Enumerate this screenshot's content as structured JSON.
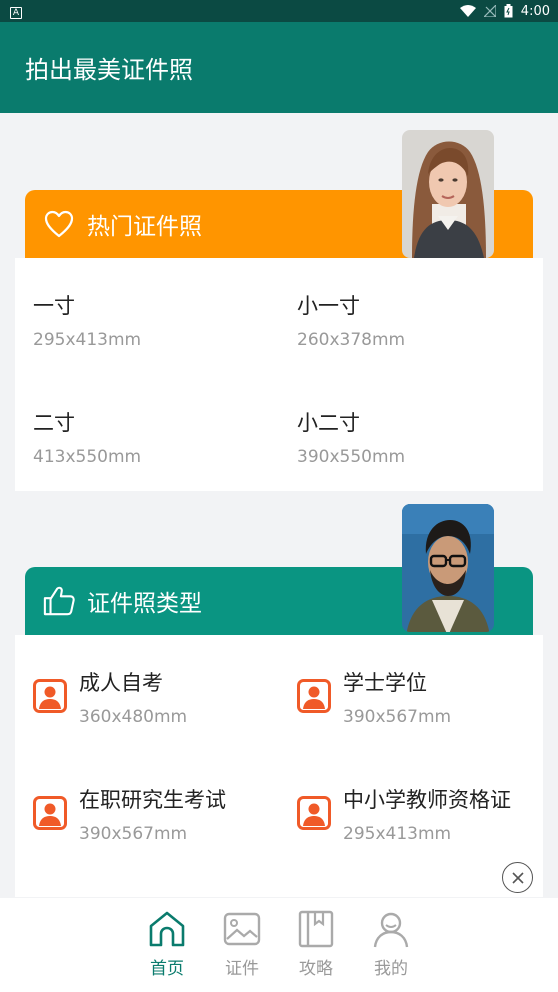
{
  "status_bar": {
    "time": "4:00",
    "left_glyph": "A"
  },
  "app_bar": {
    "title": "拍出最美证件照"
  },
  "hot_section": {
    "title": "热门证件照",
    "items": [
      {
        "name": "一寸",
        "size": "295x413mm"
      },
      {
        "name": "小一寸",
        "size": "260x378mm"
      },
      {
        "name": "二寸",
        "size": "413x550mm"
      },
      {
        "name": "小二寸",
        "size": "390x550mm"
      }
    ]
  },
  "type_section": {
    "title": "证件照类型",
    "items": [
      {
        "name": "成人自考",
        "size": "360x480mm"
      },
      {
        "name": "学士学位",
        "size": "390x567mm"
      },
      {
        "name": "在职研究生考试",
        "size": "390x567mm"
      },
      {
        "name": "中小学教师资格证",
        "size": "295x413mm"
      }
    ]
  },
  "bottom_nav": {
    "items": [
      {
        "label": "首页",
        "icon": "home-icon",
        "active": true
      },
      {
        "label": "证件",
        "icon": "image-icon",
        "active": false
      },
      {
        "label": "攻略",
        "icon": "book-icon",
        "active": false
      },
      {
        "label": "我的",
        "icon": "user-icon",
        "active": false
      }
    ]
  },
  "colors": {
    "app_bar": "#0a7b6d",
    "status_bar": "#0b4a43",
    "hot_header": "#ff9500",
    "type_header": "#0a9582",
    "person_icon": "#f05a28"
  }
}
